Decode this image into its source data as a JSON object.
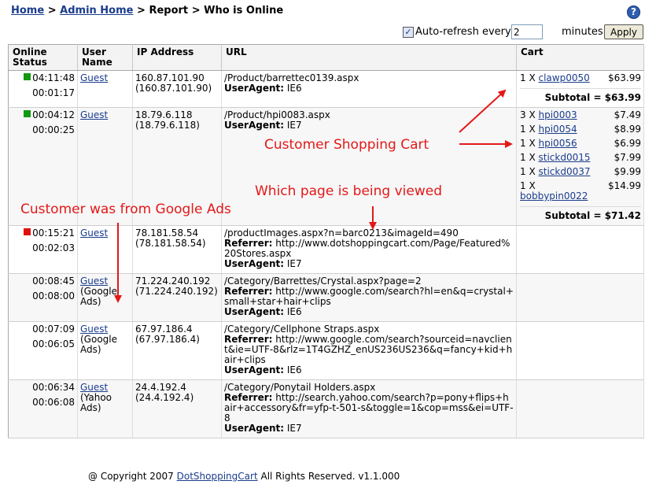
{
  "breadcrumb": {
    "home": "Home",
    "sep1": ">",
    "admin_home": "Admin Home",
    "sep2": ">",
    "report": "Report",
    "sep3": ">",
    "current": "Who is Online"
  },
  "help_icon": "?",
  "refresh": {
    "checkbox_mark": "✓",
    "label": "Auto-refresh every",
    "value": "2",
    "unit": "minutes",
    "apply": "Apply"
  },
  "table": {
    "headers": {
      "status": "Online Status",
      "user": "User Name",
      "ip": "IP Address",
      "url": "URL",
      "cart": "Cart"
    },
    "rows": [
      {
        "status_color": "#119911",
        "time1": "04:11:48",
        "time2": "00:01:17",
        "user": "Guest",
        "source": "",
        "ip": "160.87.101.90",
        "ip2": "(160.87.101.90)",
        "url": "/Product/barrettec0139.aspx",
        "referrer_label": "",
        "referrer": "",
        "ua_label": "UserAgent:",
        "ua": "IE6",
        "cart": [
          {
            "qty": "1 X",
            "item": "clawp0050",
            "price": "$63.99"
          }
        ],
        "subtotal_label": "Subtotal =",
        "subtotal": "$63.99"
      },
      {
        "status_color": "#119911",
        "time1": "00:04:12",
        "time2": "00:00:25",
        "user": "Guest",
        "source": "",
        "ip": "18.79.6.118",
        "ip2": "(18.79.6.118)",
        "url": "/Product/hpi0083.aspx",
        "referrer_label": "",
        "referrer": "",
        "ua_label": "UserAgent:",
        "ua": "IE7",
        "cart": [
          {
            "qty": "3 X",
            "item": "hpi0003",
            "price": "$7.49"
          },
          {
            "qty": "1 X",
            "item": "hpi0054",
            "price": "$8.99"
          },
          {
            "qty": "1 X",
            "item": "hpi0056",
            "price": "$6.99"
          },
          {
            "qty": "1 X",
            "item": "stickd0015",
            "price": "$7.99"
          },
          {
            "qty": "1 X",
            "item": "stickd0037",
            "price": "$9.99"
          },
          {
            "qty": "1 X",
            "item": "bobbypin0022",
            "price": "$14.99"
          }
        ],
        "subtotal_label": "Subtotal =",
        "subtotal": "$71.42"
      },
      {
        "status_color": "#e01010",
        "time1": "00:15:21",
        "time2": "00:02:03",
        "user": "Guest",
        "source": "",
        "ip": "78.181.58.54",
        "ip2": "(78.181.58.54)",
        "url": "/productImages.aspx?n=barc0213&imageId=490",
        "referrer_label": "Referrer:",
        "referrer": "http://www.dotshoppingcart.com/Page/Featured%20Stores.aspx",
        "ua_label": "UserAgent:",
        "ua": "IE7",
        "cart": [],
        "subtotal_label": "",
        "subtotal": ""
      },
      {
        "status_color": "",
        "time1": "00:08:45",
        "time2": "00:08:00",
        "user": "Guest",
        "source": "(Google Ads)",
        "ip": "71.224.240.192",
        "ip2": "(71.224.240.192)",
        "url": "/Category/Barrettes/Crystal.aspx?page=2",
        "referrer_label": "Referrer:",
        "referrer": "http://www.google.com/search?hl=en&q=crystal+small+star+hair+clips",
        "ua_label": "UserAgent:",
        "ua": "IE6",
        "cart": [],
        "subtotal_label": "",
        "subtotal": ""
      },
      {
        "status_color": "",
        "time1": "00:07:09",
        "time2": "00:06:05",
        "user": "Guest",
        "source": "(Google Ads)",
        "ip": "67.97.186.4",
        "ip2": "(67.97.186.4)",
        "url": "/Category/Cellphone Straps.aspx",
        "referrer_label": "Referrer:",
        "referrer": "http://www.google.com/search?sourceid=navclient&ie=UTF-8&rlz=1T4GZHZ_enUS236US236&q=fancy+kid+hair+clips",
        "ua_label": "UserAgent:",
        "ua": "IE6",
        "cart": [],
        "subtotal_label": "",
        "subtotal": ""
      },
      {
        "status_color": "",
        "time1": "00:06:34",
        "time2": "00:06:08",
        "user": "Guest",
        "source": "(Yahoo Ads)",
        "ip": "24.4.192.4",
        "ip2": "(24.4.192.4)",
        "url": "/Category/Ponytail Holders.aspx",
        "referrer_label": "Referrer:",
        "referrer": "http://search.yahoo.com/search?p=pony+flips+hair+accessory&fr=yfp-t-501-s&toggle=1&cop=mss&ei=UTF-8",
        "ua_label": "UserAgent:",
        "ua": "IE7",
        "cart": [],
        "subtotal_label": "",
        "subtotal": ""
      }
    ]
  },
  "annotations": {
    "cart": "Customer Shopping Cart",
    "page": "Which page is being viewed",
    "google": "Customer was from Google Ads",
    "color": "#e41818"
  },
  "footer": {
    "prefix": "@ Copyright 2007",
    "link": "DotShoppingCart",
    "suffix": "All Rights Reserved. v1.1.000"
  }
}
